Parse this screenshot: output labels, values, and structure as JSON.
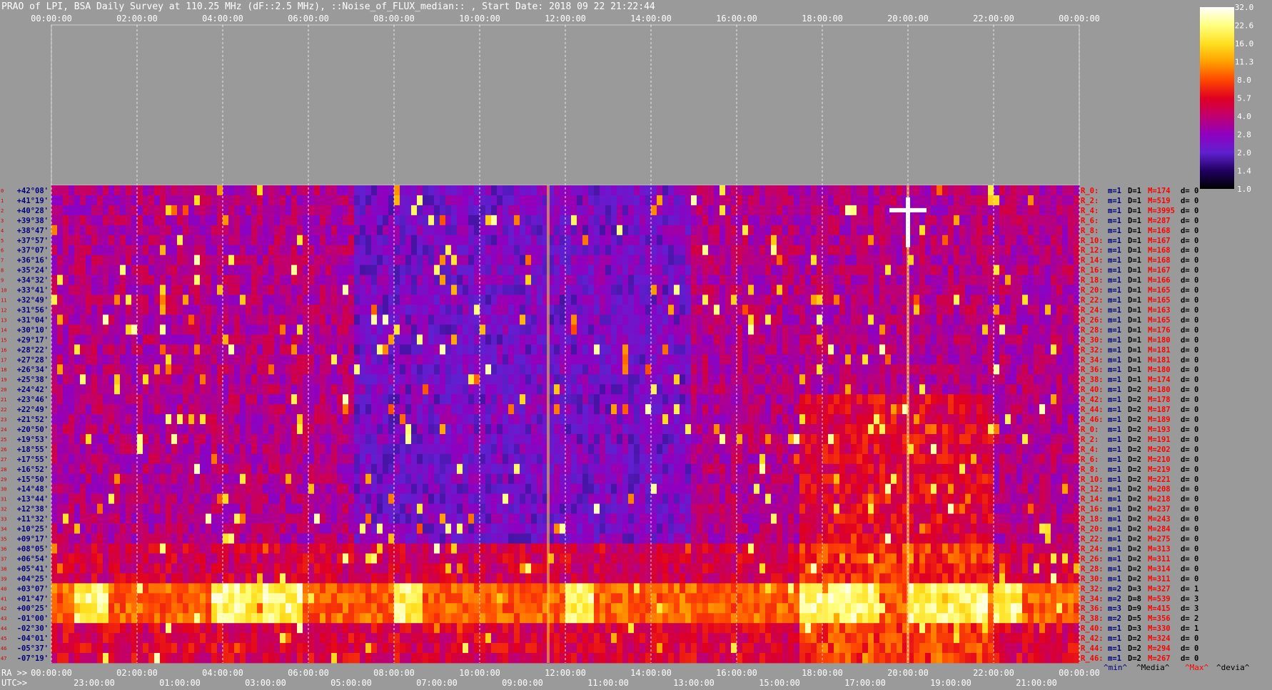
{
  "title": "PRAO of LPI, BSA Daily Survey at 110.25 MHz (dF::2.5 MHz), ::Noise_of_FLUX_median:: , Start Date: 2018 09 22 21:22:44",
  "chart_data": {
    "type": "heatmap",
    "title": "PRAO of LPI, BSA Daily Survey at 110.25 MHz (dF::2.5 MHz), ::Noise_of_FLUX_median:: , Start Date: 2018 09 22 21:22:44",
    "top_time_ticks": [
      "00:00:00",
      "02:00:00",
      "04:00:00",
      "06:00:00",
      "08:00:00",
      "10:00:00",
      "12:00:00",
      "14:00:00",
      "16:00:00",
      "18:00:00",
      "20:00:00",
      "22:00:00",
      "00:00:00"
    ],
    "ra_label": "RA >>",
    "utc_label": "UTC>>",
    "ra_ticks": [
      "00:00:00",
      "02:00:00",
      "04:00:00",
      "06:00:00",
      "08:00:00",
      "10:00:00",
      "12:00:00",
      "14:00:00",
      "16:00:00",
      "18:00:00",
      "20:00:00",
      "22:00:00",
      "00:00:00"
    ],
    "utc_ticks": [
      "23:00:00",
      "01:00:00",
      "03:00:00",
      "05:00:00",
      "07:00:00",
      "09:00:00",
      "11:00:00",
      "13:00:00",
      "15:00:00",
      "17:00:00",
      "19:00:00",
      "21:00:00"
    ],
    "declinations": [
      "+42°08'",
      "+41°19'",
      "+40°28'",
      "+39°38'",
      "+38°47'",
      "+37°57'",
      "+37°07'",
      "+36°16'",
      "+35°24'",
      "+34°32'",
      "+33°41'",
      "+32°49'",
      "+31°56'",
      "+31°04'",
      "+30°10'",
      "+29°17'",
      "+28°22'",
      "+27°28'",
      "+26°34'",
      "+25°38'",
      "+24°42'",
      "+23°46'",
      "+22°49'",
      "+21°52'",
      "+20°50'",
      "+19°53'",
      "+18°55'",
      "+17°55'",
      "+16°52'",
      "+15°50'",
      "+14°48'",
      "+13°44'",
      "+12°38'",
      "+11°32'",
      "+10°25'",
      "+09°17'",
      "+08°05'",
      "+06°54'",
      "+05°41'",
      "+04°25'",
      "+03°07'",
      "+01°47'",
      "+00°25'",
      "-01°00'",
      "-02°30'",
      "-04°01'",
      "-05°37'",
      "-07°19'"
    ],
    "colorbar": {
      "ticks": [
        "32.0",
        "22.6",
        "16.0",
        "11.3",
        "8.0",
        "5.7",
        "4.0",
        "2.8",
        "2.0",
        "1.4",
        "1.0"
      ],
      "colors": [
        "#ffffff",
        "#ffff80",
        "#ffe020",
        "#ffa000",
        "#ff4800",
        "#e00020",
        "#c00070",
        "#9000c0",
        "#6020d0",
        "#200060",
        "#000000"
      ]
    },
    "stats_header": [
      "^min^",
      "^Media^",
      "^Max^",
      "^devia^"
    ],
    "stats_header_colors": [
      "#000080",
      "#000000",
      "#ff0000",
      "#000000"
    ],
    "stats_rows": [
      {
        "r": "R_0:",
        "m": "m=1",
        "D": "D=1",
        "M": "M=174",
        "d": "d= 0"
      },
      {
        "r": "R_2:",
        "m": "m=1",
        "D": "D=1",
        "M": "M=519",
        "d": "d= 0"
      },
      {
        "r": "R_4:",
        "m": "m=1",
        "D": "D=1",
        "M": "M=3995",
        "d": "d= 0"
      },
      {
        "r": "R_6:",
        "m": "m=1",
        "D": "D=1",
        "M": "M=287",
        "d": "d= 0"
      },
      {
        "r": "R_8:",
        "m": "m=1",
        "D": "D=1",
        "M": "M=168",
        "d": "d= 0"
      },
      {
        "r": "R_10:",
        "m": "m=1",
        "D": "D=1",
        "M": "M=167",
        "d": "d= 0"
      },
      {
        "r": "R_12:",
        "m": "m=1",
        "D": "D=1",
        "M": "M=168",
        "d": "d= 0"
      },
      {
        "r": "R_14:",
        "m": "m=1",
        "D": "D=1",
        "M": "M=168",
        "d": "d= 0"
      },
      {
        "r": "R_16:",
        "m": "m=1",
        "D": "D=1",
        "M": "M=167",
        "d": "d= 0"
      },
      {
        "r": "R_18:",
        "m": "m=1",
        "D": "D=1",
        "M": "M=166",
        "d": "d= 0"
      },
      {
        "r": "R_20:",
        "m": "m=1",
        "D": "D=1",
        "M": "M=165",
        "d": "d= 0"
      },
      {
        "r": "R_22:",
        "m": "m=1",
        "D": "D=1",
        "M": "M=165",
        "d": "d= 0"
      },
      {
        "r": "R_24:",
        "m": "m=1",
        "D": "D=1",
        "M": "M=163",
        "d": "d= 0"
      },
      {
        "r": "R_26:",
        "m": "m=1",
        "D": "D=1",
        "M": "M=165",
        "d": "d= 0"
      },
      {
        "r": "R_28:",
        "m": "m=1",
        "D": "D=1",
        "M": "M=176",
        "d": "d= 0"
      },
      {
        "r": "R_30:",
        "m": "m=1",
        "D": "D=1",
        "M": "M=180",
        "d": "d= 0"
      },
      {
        "r": "R_32:",
        "m": "m=1",
        "D": "D=1",
        "M": "M=181",
        "d": "d= 0"
      },
      {
        "r": "R_34:",
        "m": "m=1",
        "D": "D=1",
        "M": "M=181",
        "d": "d= 0"
      },
      {
        "r": "R_36:",
        "m": "m=1",
        "D": "D=1",
        "M": "M=180",
        "d": "d= 0"
      },
      {
        "r": "R_38:",
        "m": "m=1",
        "D": "D=1",
        "M": "M=174",
        "d": "d= 0"
      },
      {
        "r": "R_40:",
        "m": "m=1",
        "D": "D=2",
        "M": "M=180",
        "d": "d= 0"
      },
      {
        "r": "R_42:",
        "m": "m=1",
        "D": "D=2",
        "M": "M=178",
        "d": "d= 0"
      },
      {
        "r": "R_44:",
        "m": "m=1",
        "D": "D=2",
        "M": "M=187",
        "d": "d= 0"
      },
      {
        "r": "R_46:",
        "m": "m=1",
        "D": "D=2",
        "M": "M=189",
        "d": "d= 0"
      },
      {
        "r": "R_0:",
        "m": "m=1",
        "D": "D=2",
        "M": "M=193",
        "d": "d= 0"
      },
      {
        "r": "R_2:",
        "m": "m=1",
        "D": "D=2",
        "M": "M=191",
        "d": "d= 0"
      },
      {
        "r": "R_4:",
        "m": "m=1",
        "D": "D=2",
        "M": "M=202",
        "d": "d= 0"
      },
      {
        "r": "R_6:",
        "m": "m=1",
        "D": "D=2",
        "M": "M=210",
        "d": "d= 0"
      },
      {
        "r": "R_8:",
        "m": "m=1",
        "D": "D=2",
        "M": "M=219",
        "d": "d= 0"
      },
      {
        "r": "R_10:",
        "m": "m=1",
        "D": "D=2",
        "M": "M=221",
        "d": "d= 0"
      },
      {
        "r": "R_12:",
        "m": "m=1",
        "D": "D=2",
        "M": "M=208",
        "d": "d= 0"
      },
      {
        "r": "R_14:",
        "m": "m=1",
        "D": "D=2",
        "M": "M=218",
        "d": "d= 0"
      },
      {
        "r": "R_16:",
        "m": "m=1",
        "D": "D=2",
        "M": "M=237",
        "d": "d= 0"
      },
      {
        "r": "R_18:",
        "m": "m=1",
        "D": "D=2",
        "M": "M=243",
        "d": "d= 0"
      },
      {
        "r": "R_20:",
        "m": "m=1",
        "D": "D=2",
        "M": "M=284",
        "d": "d= 0"
      },
      {
        "r": "R_22:",
        "m": "m=1",
        "D": "D=2",
        "M": "M=275",
        "d": "d= 0"
      },
      {
        "r": "R_24:",
        "m": "m=1",
        "D": "D=2",
        "M": "M=313",
        "d": "d= 0"
      },
      {
        "r": "R_26:",
        "m": "m=1",
        "D": "D=2",
        "M": "M=311",
        "d": "d= 0"
      },
      {
        "r": "R_28:",
        "m": "m=1",
        "D": "D=2",
        "M": "M=314",
        "d": "d= 0"
      },
      {
        "r": "R_30:",
        "m": "m=1",
        "D": "D=2",
        "M": "M=311",
        "d": "d= 0"
      },
      {
        "r": "R_32:",
        "m": "m=2",
        "D": "D=3",
        "M": "M=327",
        "d": "d= 1"
      },
      {
        "r": "R_34:",
        "m": "m=2",
        "D": "D=8",
        "M": "M=539",
        "d": "d= 3"
      },
      {
        "r": "R_36:",
        "m": "m=3",
        "D": "D=9",
        "M": "M=415",
        "d": "d= 3"
      },
      {
        "r": "R_38:",
        "m": "m=2",
        "D": "D=5",
        "M": "M=356",
        "d": "d= 2"
      },
      {
        "r": "R_40:",
        "m": "m=1",
        "D": "D=3",
        "M": "M=330",
        "d": "d= 1"
      },
      {
        "r": "R_42:",
        "m": "m=1",
        "D": "D=2",
        "M": "M=324",
        "d": "d= 0"
      },
      {
        "r": "R_44:",
        "m": "m=1",
        "D": "D=2",
        "M": "M=294",
        "d": "d= 0"
      },
      {
        "r": "R_46:",
        "m": "m=1",
        "D": "D=2",
        "M": "M=267",
        "d": "d= 0"
      }
    ],
    "bright_band_rows": [
      40,
      41,
      42,
      43
    ],
    "bright_hours": [
      [
        0.5,
        1.3
      ],
      [
        3.7,
        5.9
      ],
      [
        8.0,
        8.6
      ],
      [
        12.0,
        12.7
      ],
      [
        17.5,
        19.3
      ],
      [
        20.0,
        21.8
      ],
      [
        22.0,
        22.6
      ]
    ],
    "bright_source": {
      "hour": 20.0,
      "row": 2,
      "value": 32.0
    },
    "bright_columns_hours": [
      11.6,
      20.0
    ],
    "colors": {
      "background": "#9a9a9a",
      "row_index_color": "#d00000",
      "dec_label_color": "#000080",
      "stats_r_color": "#ff0000",
      "stats_mD_color": "#000080",
      "stats_M_color": "#ff0000",
      "text_color": "#ffffff"
    }
  }
}
